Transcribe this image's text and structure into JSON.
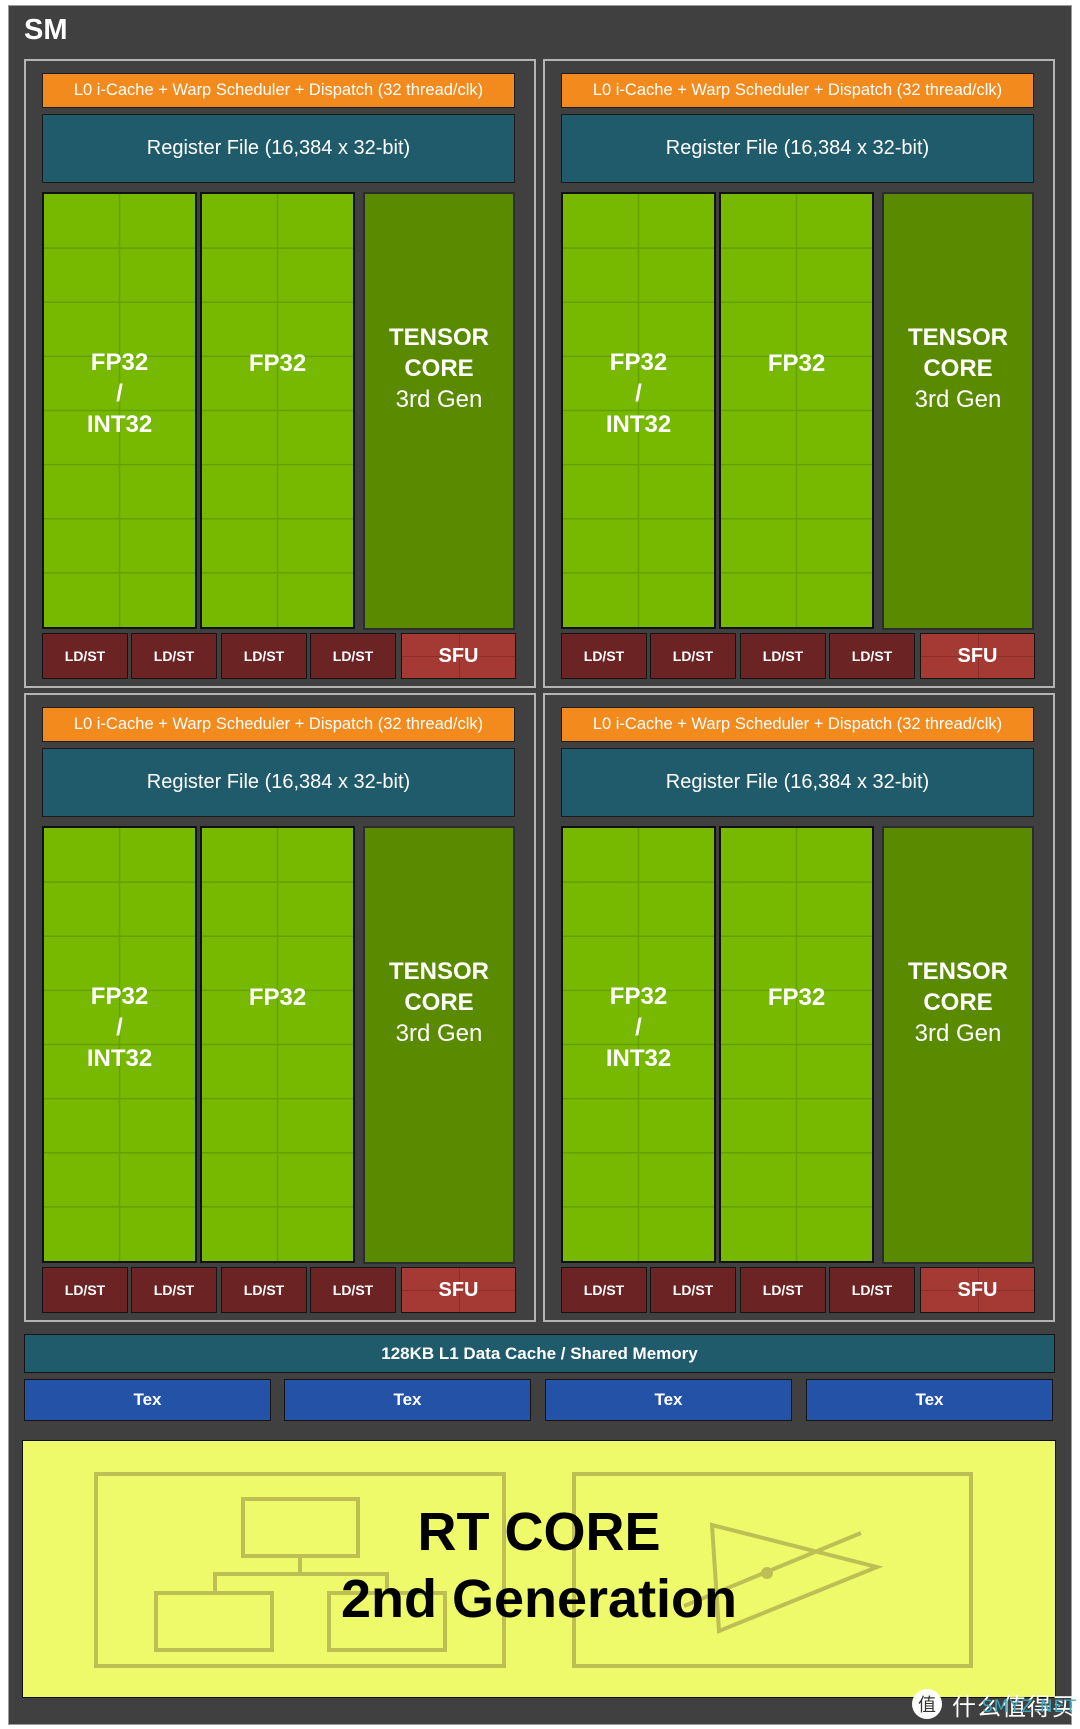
{
  "diagram": {
    "title": "SM",
    "partitions": [
      {
        "id": "top-left",
        "warp_scheduler": "L0 i-Cache + Warp Scheduler + Dispatch (32 thread/clk)",
        "register_file": "Register File (16,384 x 32-bit)",
        "fp_int_unit": [
          "FP32",
          "/",
          "INT32"
        ],
        "fp_unit": "FP32",
        "tensor_core": [
          "TENSOR",
          "CORE",
          "3rd Gen"
        ],
        "ldst_units": [
          "LD/ST",
          "LD/ST",
          "LD/ST",
          "LD/ST"
        ],
        "sfu": "SFU"
      },
      {
        "id": "top-right",
        "warp_scheduler": "L0 i-Cache + Warp Scheduler + Dispatch (32 thread/clk)",
        "register_file": "Register File (16,384 x 32-bit)",
        "fp_int_unit": [
          "FP32",
          "/",
          "INT32"
        ],
        "fp_unit": "FP32",
        "tensor_core": [
          "TENSOR",
          "CORE",
          "3rd Gen"
        ],
        "ldst_units": [
          "LD/ST",
          "LD/ST",
          "LD/ST",
          "LD/ST"
        ],
        "sfu": "SFU"
      },
      {
        "id": "bottom-left",
        "warp_scheduler": "L0 i-Cache + Warp Scheduler + Dispatch (32 thread/clk)",
        "register_file": "Register File (16,384 x 32-bit)",
        "fp_int_unit": [
          "FP32",
          "/",
          "INT32"
        ],
        "fp_unit": "FP32",
        "tensor_core": [
          "TENSOR",
          "CORE",
          "3rd Gen"
        ],
        "ldst_units": [
          "LD/ST",
          "LD/ST",
          "LD/ST",
          "LD/ST"
        ],
        "sfu": "SFU"
      },
      {
        "id": "bottom-right",
        "warp_scheduler": "L0 i-Cache + Warp Scheduler + Dispatch (32 thread/clk)",
        "register_file": "Register File (16,384 x 32-bit)",
        "fp_int_unit": [
          "FP32",
          "/",
          "INT32"
        ],
        "fp_unit": "FP32",
        "tensor_core": [
          "TENSOR",
          "CORE",
          "3rd Gen"
        ],
        "ldst_units": [
          "LD/ST",
          "LD/ST",
          "LD/ST",
          "LD/ST"
        ],
        "sfu": "SFU"
      }
    ],
    "l1_cache": "128KB L1 Data Cache / Shared Memory",
    "tex_units": [
      "Tex",
      "Tex",
      "Tex",
      "Tex"
    ],
    "rt_core": {
      "line1": "RT CORE",
      "line2": "2nd Generation",
      "icons": [
        "bvh-tree-icon",
        "ray-triangle-intersection-icon"
      ]
    },
    "colors": {
      "background": "#404040",
      "warp_scheduler": "#f28a1e",
      "register_file": "#205b6c",
      "fp32": "#76b900",
      "tensor_core": "#5a8a00",
      "ldst": "#6b2323",
      "sfu": "#a53a35",
      "tex": "#2452a6",
      "rt_core": "#eefa6a"
    }
  },
  "watermark": {
    "logo_char": "值",
    "text": "什么值得买",
    "overlay": "SMYZ.NET"
  }
}
